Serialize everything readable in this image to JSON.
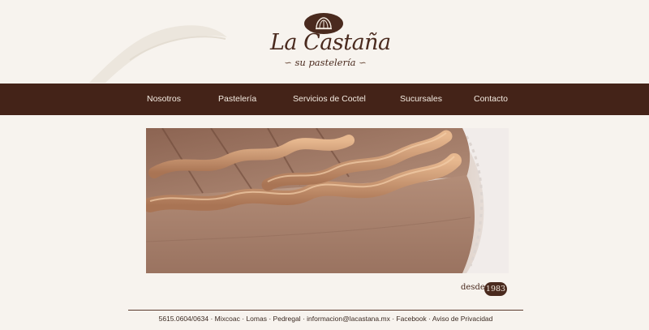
{
  "brand": {
    "name": "La Castaña",
    "tagline": "su pastelería"
  },
  "nav": {
    "items": [
      {
        "label": "Nosotros"
      },
      {
        "label": "Pastelería"
      },
      {
        "label": "Servicios de Coctel"
      },
      {
        "label": "Sucursales"
      },
      {
        "label": "Contacto"
      }
    ]
  },
  "hero": {
    "image_subject": "chestnut-cake-photo"
  },
  "since": {
    "label": "desde",
    "year": "1983"
  },
  "footer": {
    "phone": "5615.0604/0634",
    "sep": "·",
    "locations": [
      "Mixcoac",
      "Lomas",
      "Pedregal"
    ],
    "email": "informacion@lacastana.mx",
    "facebook": "Facebook",
    "privacy": "Aviso de Privacidad"
  },
  "colors": {
    "background": "#f7f3ee",
    "brand_brown": "#4a2a1e",
    "nav_bar": "#442318",
    "nav_text": "#f5ece2"
  }
}
